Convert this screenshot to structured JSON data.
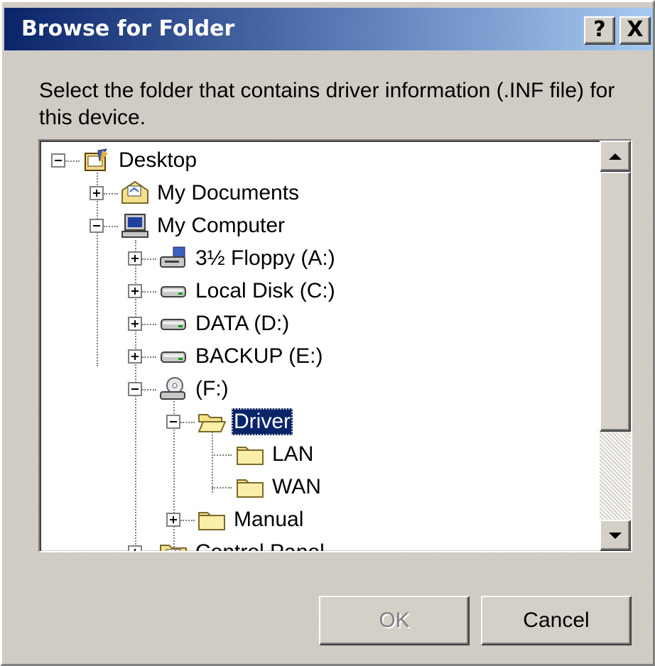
{
  "window": {
    "title": "Browse for Folder",
    "help_label": "?",
    "close_label": "X"
  },
  "prompt": "Select the folder that contains driver information (.INF file) for this device.",
  "tree": {
    "desktop": "Desktop",
    "my_documents": "My Documents",
    "my_computer": "My Computer",
    "floppy": "3½ Floppy (A:)",
    "local_disk": "Local Disk (C:)",
    "data": "DATA (D:)",
    "backup": "BACKUP (E:)",
    "cd_drive": "(F:)",
    "driver": "Driver",
    "lan": "LAN",
    "wan": "WAN",
    "manual": "Manual",
    "control_panel": "Control Panel",
    "selected": "Driver"
  },
  "buttons": {
    "ok": "OK",
    "cancel": "Cancel",
    "ok_enabled": false
  },
  "colors": {
    "title_start": "#0a246a",
    "title_end": "#a6caf0",
    "selection": "#0a246a",
    "face": "#d4d0c8",
    "folder": "#f5e08c"
  },
  "icons": {
    "desktop": "desktop-icon",
    "my_documents": "my-documents-folder-icon",
    "my_computer": "computer-icon",
    "floppy": "floppy-drive-icon",
    "hard_disk": "hard-disk-icon",
    "cd_drive": "cd-drive-icon",
    "folder": "folder-icon",
    "open_folder": "open-folder-icon",
    "control_panel": "control-panel-icon"
  }
}
